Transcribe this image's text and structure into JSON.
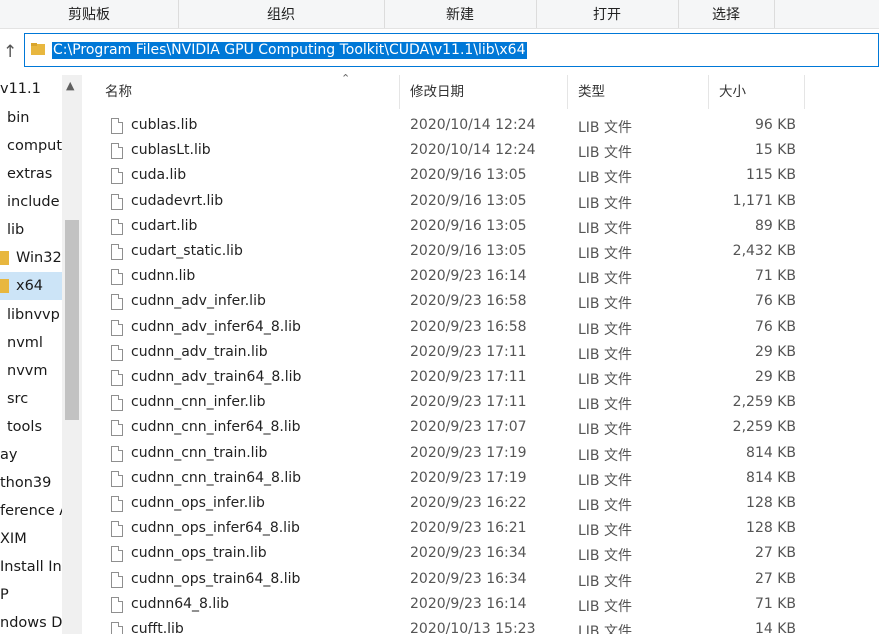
{
  "ribbon": {
    "groups": [
      "剪贴板",
      "组织",
      "新建",
      "打开",
      "选择"
    ]
  },
  "address_bar": {
    "path": "C:\\Program Files\\NVIDIA GPU Computing Toolkit\\CUDA\\v11.1\\lib\\x64"
  },
  "nav": {
    "items": [
      {
        "label": "v11.1",
        "selected": false
      },
      {
        "label": "bin",
        "selected": false
      },
      {
        "label": "compute",
        "selected": false
      },
      {
        "label": "extras",
        "selected": false
      },
      {
        "label": "include",
        "selected": false
      },
      {
        "label": "lib",
        "selected": false
      },
      {
        "label": "Win32",
        "selected": false
      },
      {
        "label": "x64",
        "selected": true
      },
      {
        "label": "libnvvp",
        "selected": false
      },
      {
        "label": "nvml",
        "selected": false
      },
      {
        "label": "nvvm",
        "selected": false
      },
      {
        "label": "src",
        "selected": false
      },
      {
        "label": "tools",
        "selected": false
      },
      {
        "label": "ay",
        "selected": false
      },
      {
        "label": "thon39",
        "selected": false
      },
      {
        "label": "ference A",
        "selected": false
      },
      {
        "label": "XIM",
        "selected": false
      },
      {
        "label": "Install Info",
        "selected": false
      },
      {
        "label": "P",
        "selected": false
      },
      {
        "label": "ndows De",
        "selected": false
      }
    ]
  },
  "columns": {
    "name": "名称",
    "date": "修改日期",
    "type": "类型",
    "size": "大小"
  },
  "files": [
    {
      "name": "cublas.lib",
      "date": "2020/10/14 12:24",
      "type": "LIB 文件",
      "size": "96 KB"
    },
    {
      "name": "cublasLt.lib",
      "date": "2020/10/14 12:24",
      "type": "LIB 文件",
      "size": "15 KB"
    },
    {
      "name": "cuda.lib",
      "date": "2020/9/16 13:05",
      "type": "LIB 文件",
      "size": "115 KB"
    },
    {
      "name": "cudadevrt.lib",
      "date": "2020/9/16 13:05",
      "type": "LIB 文件",
      "size": "1,171 KB"
    },
    {
      "name": "cudart.lib",
      "date": "2020/9/16 13:05",
      "type": "LIB 文件",
      "size": "89 KB"
    },
    {
      "name": "cudart_static.lib",
      "date": "2020/9/16 13:05",
      "type": "LIB 文件",
      "size": "2,432 KB"
    },
    {
      "name": "cudnn.lib",
      "date": "2020/9/23 16:14",
      "type": "LIB 文件",
      "size": "71 KB"
    },
    {
      "name": "cudnn_adv_infer.lib",
      "date": "2020/9/23 16:58",
      "type": "LIB 文件",
      "size": "76 KB"
    },
    {
      "name": "cudnn_adv_infer64_8.lib",
      "date": "2020/9/23 16:58",
      "type": "LIB 文件",
      "size": "76 KB"
    },
    {
      "name": "cudnn_adv_train.lib",
      "date": "2020/9/23 17:11",
      "type": "LIB 文件",
      "size": "29 KB"
    },
    {
      "name": "cudnn_adv_train64_8.lib",
      "date": "2020/9/23 17:11",
      "type": "LIB 文件",
      "size": "29 KB"
    },
    {
      "name": "cudnn_cnn_infer.lib",
      "date": "2020/9/23 17:11",
      "type": "LIB 文件",
      "size": "2,259 KB"
    },
    {
      "name": "cudnn_cnn_infer64_8.lib",
      "date": "2020/9/23 17:07",
      "type": "LIB 文件",
      "size": "2,259 KB"
    },
    {
      "name": "cudnn_cnn_train.lib",
      "date": "2020/9/23 17:19",
      "type": "LIB 文件",
      "size": "814 KB"
    },
    {
      "name": "cudnn_cnn_train64_8.lib",
      "date": "2020/9/23 17:19",
      "type": "LIB 文件",
      "size": "814 KB"
    },
    {
      "name": "cudnn_ops_infer.lib",
      "date": "2020/9/23 16:22",
      "type": "LIB 文件",
      "size": "128 KB"
    },
    {
      "name": "cudnn_ops_infer64_8.lib",
      "date": "2020/9/23 16:21",
      "type": "LIB 文件",
      "size": "128 KB"
    },
    {
      "name": "cudnn_ops_train.lib",
      "date": "2020/9/23 16:34",
      "type": "LIB 文件",
      "size": "27 KB"
    },
    {
      "name": "cudnn_ops_train64_8.lib",
      "date": "2020/9/23 16:34",
      "type": "LIB 文件",
      "size": "27 KB"
    },
    {
      "name": "cudnn64_8.lib",
      "date": "2020/9/23 16:14",
      "type": "LIB 文件",
      "size": "71 KB"
    },
    {
      "name": "cufft.lib",
      "date": "2020/10/13 15:23",
      "type": "LIB 文件",
      "size": "14 KB"
    }
  ],
  "colors": {
    "selection": "#0078d7",
    "nav_selected": "#cce4f7",
    "folder": "#e8b73f"
  }
}
